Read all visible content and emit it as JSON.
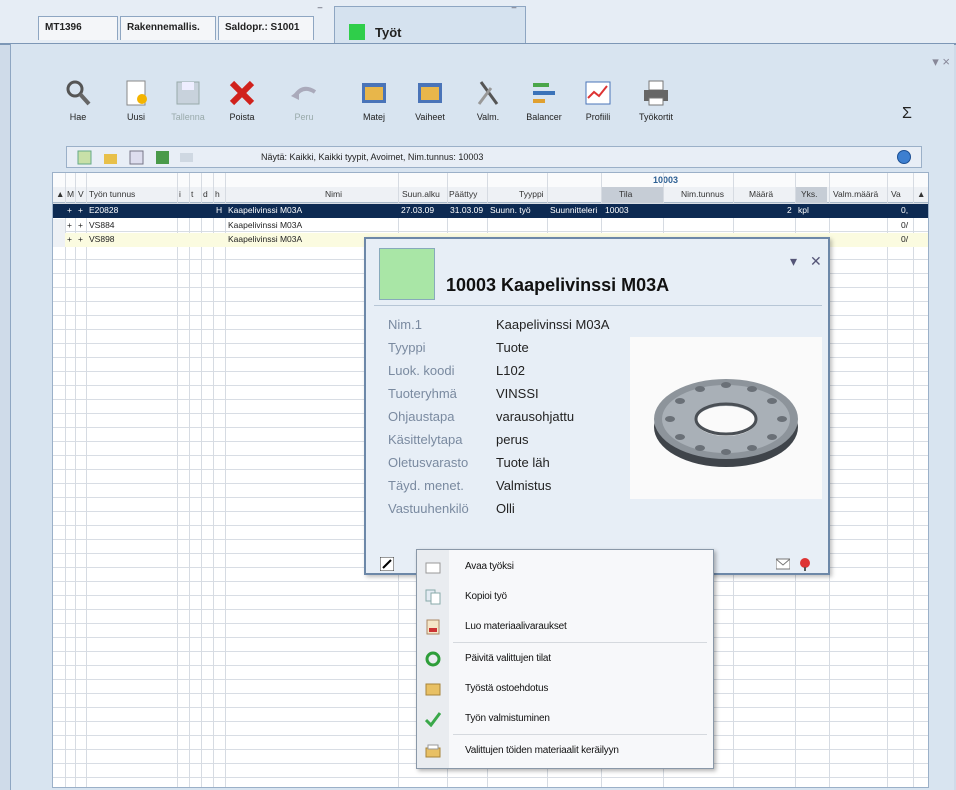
{
  "tabs": [
    {
      "label": "MT1396"
    },
    {
      "label": "Rakennemallis."
    },
    {
      "label": "Saldopr.: S1001"
    },
    {
      "label": "Työt"
    }
  ],
  "toolbar": {
    "items": [
      {
        "label": "Hae",
        "icon": "search-icon"
      },
      {
        "label": "Uusi",
        "icon": "new-document-icon"
      },
      {
        "label": "Tallenna",
        "icon": "save-icon"
      },
      {
        "label": "Poista",
        "icon": "delete-icon"
      },
      {
        "label": "Peru",
        "icon": "undo-icon"
      },
      {
        "label": "Matej",
        "icon": "materials-icon"
      },
      {
        "label": "Vaiheet",
        "icon": "phases-icon"
      },
      {
        "label": "Valm.",
        "icon": "tools-icon"
      },
      {
        "label": "Balancer",
        "icon": "balancer-icon"
      },
      {
        "label": "Profiili",
        "icon": "profile-chart-icon"
      },
      {
        "label": "Työkortit",
        "icon": "printer-icon"
      }
    ],
    "sigma": "Σ"
  },
  "filter": {
    "text": "Näytä: Kaikki, Kaikki tyypit, Avoimet, Nim.tunnus: 10003"
  },
  "grid": {
    "top_code": "10003",
    "columns": [
      "M",
      "V",
      "Työn tunnus",
      "i",
      "t",
      "d",
      "h",
      "Nimi",
      "Suun.alku",
      "Päättyy",
      "Tyyppi",
      "Tila",
      "Nim.tunnus",
      "Määrä",
      "Yks.",
      "Valm.määrä",
      "Va"
    ],
    "rows": [
      {
        "m": "+",
        "v": "+",
        "id": "E20828",
        "h": "H",
        "name": "Kaapelivinssi M03A",
        "start": "27.03.09",
        "end": "31.03.09",
        "type": "Suunn. työ",
        "status": "Suunnitteleri",
        "code": "10003",
        "qty": "2",
        "unit": "kpl",
        "extra": "0,"
      },
      {
        "m": "+",
        "v": "+",
        "id": "VS884",
        "h": "",
        "name": "Kaapelivinssi M03A",
        "start": "",
        "end": "",
        "type": "",
        "status": "",
        "code": "",
        "qty": "",
        "unit": "",
        "extra": "0/"
      },
      {
        "m": "+",
        "v": "+",
        "id": "VS898",
        "h": "",
        "name": "Kaapelivinssi M03A",
        "start": "",
        "end": "",
        "type": "",
        "status": "",
        "code": "",
        "qty": "",
        "unit": "",
        "extra": "0/"
      }
    ]
  },
  "popup": {
    "title": "10003  Kaapelivinssi M03A",
    "swatch_color": "#a9e6a6",
    "properties": [
      {
        "key": "Nim.1",
        "value": "Kaapelivinssi M03A"
      },
      {
        "key": "Tyyppi",
        "value": "Tuote"
      },
      {
        "key": "Luok. koodi",
        "value": "L102"
      },
      {
        "key": "Tuoteryhmä",
        "value": "VINSSI"
      },
      {
        "key": "Ohjaustapa",
        "value": "varausohjattu"
      },
      {
        "key": "Käsittelytapa",
        "value": "perus"
      },
      {
        "key": "Oletusvarasto",
        "value": "Tuote läh"
      },
      {
        "key": "Täyd. menet.",
        "value": "Valmistus"
      },
      {
        "key": "Vastuuhenkilö",
        "value": "Olli"
      }
    ]
  },
  "context_menu": {
    "items": [
      {
        "label": "Avaa työksi",
        "icon": "folder-open-icon"
      },
      {
        "label": "Kopioi työ",
        "icon": "copy-icon"
      },
      {
        "label": "Luo materiaalivaraukset",
        "icon": "reserve-icon"
      },
      {
        "label": "Päivitä valittujen tilat",
        "icon": "refresh-icon"
      },
      {
        "label": "Työstä ostoehdotus",
        "icon": "purchase-icon"
      },
      {
        "label": "Työn valmistuminen",
        "icon": "check-icon"
      },
      {
        "label": "Valittujen töiden materiaalit keräilyyn",
        "icon": "picking-icon"
      }
    ]
  }
}
